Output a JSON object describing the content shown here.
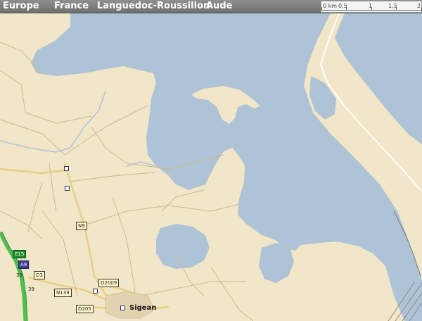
{
  "breadcrumb": [
    {
      "label": "Europe"
    },
    {
      "label": "France"
    },
    {
      "label": "Languedoc-Roussillon"
    },
    {
      "label": "Aude"
    }
  ],
  "scale": {
    "labels": [
      "0 km",
      "0,5",
      "1",
      "1,5",
      "2"
    ]
  },
  "roads": {
    "E15": "E15",
    "A9": "A9",
    "N9": "N9",
    "D3": "D3",
    "D2009": "D2009",
    "N139": "N139",
    "D205": "D205",
    "exit_top": "39",
    "exit_bottom": "39"
  },
  "places": {
    "town": "Sigean"
  },
  "colors": {
    "land": "#f2e6c8",
    "water": "#afc3d6",
    "bar": "#7f7f7f",
    "motorway": "#4fbf4f",
    "road": "#d8c18a"
  }
}
